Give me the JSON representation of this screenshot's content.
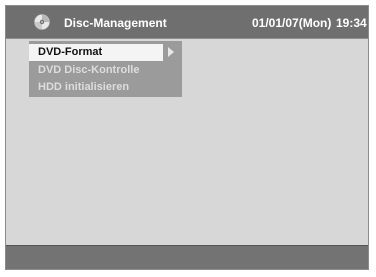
{
  "header": {
    "title": "Disc-Management",
    "date": "01/01/07(Mon)",
    "time": "19:34",
    "icon": "disc-icon"
  },
  "menu": {
    "items": [
      {
        "label": "DVD-Format",
        "selected": true,
        "has_submenu": true
      },
      {
        "label": "DVD Disc-Kontrolle",
        "selected": false
      },
      {
        "label": "HDD initialisieren",
        "selected": false
      }
    ],
    "submenu_icon": "arrow-right-icon"
  },
  "colors": {
    "background": "#d7d7d7",
    "header": "#6f6f6f",
    "menu_panel": "#9b9b9b",
    "selected_item": "#f4f4f4",
    "footer": "#737373"
  }
}
